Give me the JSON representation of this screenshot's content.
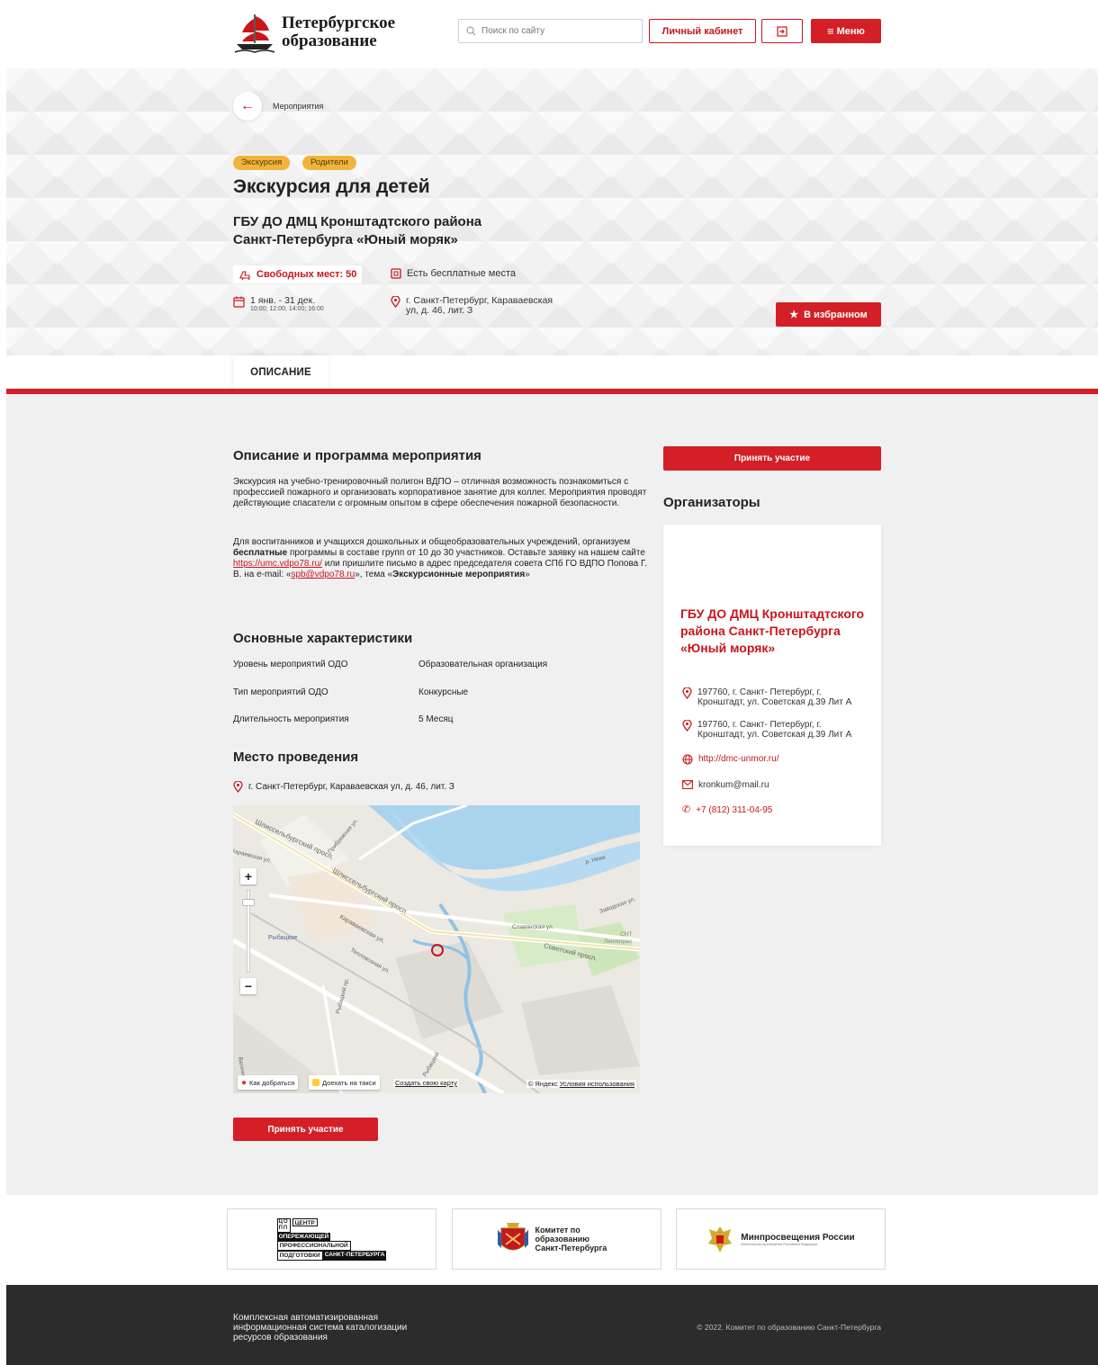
{
  "header": {
    "logo_line1": "Петербургское",
    "logo_line2": "образование",
    "search_placeholder": "Поиск по сайту",
    "cabinet_label": "Личный кабинет",
    "menu_label": "Меню"
  },
  "hero": {
    "breadcrumb": "Мероприятия",
    "tags": [
      "Экскурсия",
      "Родители"
    ],
    "title": "Экскурсия для детей",
    "organizer": "ГБУ ДО ДМЦ Кронштадтского района Санкт-Петербурга «Юный моряк»",
    "seats": "Свободных мест: 50",
    "free_places": "Есть бесплатные места",
    "dates": "1 янв. - 31 дек.",
    "times": "10:00; 12:00; 14:00; 16:00",
    "address": "г. Санкт-Петербург, Караваевская ул, д. 46, лит. З",
    "favorite_label": "В избранном"
  },
  "tabs": {
    "description": "ОПИСАНИЕ"
  },
  "description": {
    "heading": "Описание и программа мероприятия",
    "para1": "Экскурсия на учебно-тренировочный полигон ВДПО – отличная возможность познакомиться с профессией пожарного и организовать корпоративное занятие для коллег. Мероприятия проводят действующие спасатели с огромным опытом в сфере обеспечения пожарной безопасности.",
    "para2_a": "Для воспитанников и учащихся дошкольных и общеобразовательных учреждений, организуем ",
    "para2_bold": "бесплатные",
    "para2_b": " программы в составе групп от 10 до 30 участников. Оставьте заявку на нашем сайте ",
    "para2_link": "https://umc.vdpo78.ru/",
    "para2_c": " или пришлите письмо в адрес председателя совета СПб ГО ВДПО Попова Г. В. на e-mail: «",
    "para2_email": "spb@vdpo78.ru",
    "para2_d": "», тема «",
    "para2_topic": "Экскурсионные мероприятия",
    "para2_e": "»"
  },
  "characteristics": {
    "heading": "Основные характеристики",
    "rows": [
      {
        "label": "Уровень мероприятий ОДО",
        "value": "Образовательная организация"
      },
      {
        "label": "Тип мероприятий ОДО",
        "value": "Конкурсные"
      },
      {
        "label": "Длительность мероприятия",
        "value": "5 Месяц"
      }
    ]
  },
  "venue": {
    "heading": "Место проведения",
    "address": "г. Санкт-Петербург, Караваевская ул, д. 46, лит. З",
    "map": {
      "route_label": "Как добраться",
      "taxi_label": "Доехать на такси",
      "create_label": "Создать свою карту",
      "copyright": "© Яндекс",
      "terms": "Условия использования",
      "streets": [
        "Шлиссельбургский просп.",
        "Шлиссельбургский просп.",
        "Караваевская ул.",
        "Славянская ул.",
        "Советский просп.",
        "Тепловозная ул.",
        "Заводская ул.",
        "р. Нева",
        "Рыбацкое",
        "СНТ",
        "Ленпогрес",
        "Рыбацкий пр.",
        "Караевская ул.",
        "Прибрежная ул.",
        "Вагонная",
        "Рыбацкий"
      ]
    }
  },
  "join_label": "Принять участие",
  "organizers": {
    "heading": "Организаторы",
    "name": "ГБУ ДО ДМЦ Кронштадтского района Санкт-Петербурга «Юный моряк»",
    "address1": "197760, г. Санкт- Петербург, г. Кронштадт, ул. Советская д.39 Лит А",
    "address2": "197760, г. Санкт- Петербург, г. Кронштадт, ул. Советская д.39 Лит А",
    "site": "http://dmc-unmor.ru/",
    "email": "kronkum@mail.ru",
    "phone": "+7 (812) 311-04-95"
  },
  "partners": {
    "cop_lines": [
      "ЦЕНТР",
      "ОПЕРЕЖАЮЩЕЙ",
      "ПРОФЕССИОНАЛЬНОЙ",
      "ПОДГОТОВКИ",
      "САНКТ-ПЕТЕРБУРГА"
    ],
    "cop_mark": [
      "ЦО",
      "ПП"
    ],
    "committee": "Комитет по образованию Санкт-Петербурга",
    "ministry": "Минпросвещения России",
    "ministry_sub": "Министерство просвещения Российской Федерации"
  },
  "footer": {
    "left": "Комплексная автоматизированная информационная система каталогизации ресурсов образования",
    "right": "© 2022. Комитет по образованию Санкт-Петербурга"
  },
  "colors": {
    "accent": "#d41f26",
    "tag": "#f0b43c",
    "footer": "#2c2c2c"
  }
}
